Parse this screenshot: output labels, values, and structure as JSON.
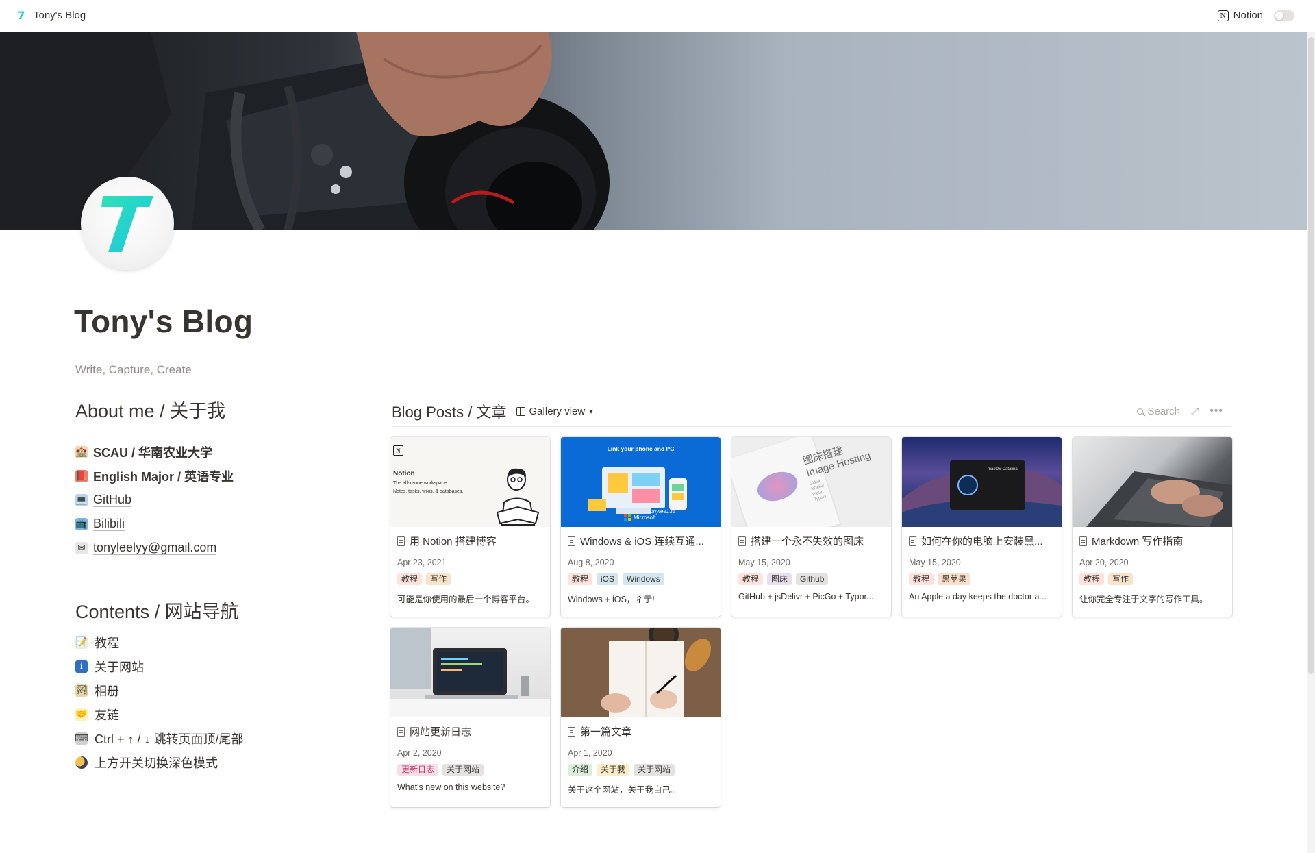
{
  "topbar": {
    "site_name": "Tony's Blog",
    "notion_label": "Notion",
    "dark_mode_enabled": false
  },
  "page": {
    "title": "Tony's Blog",
    "subtitle": "Write, Capture, Create"
  },
  "about": {
    "heading": "About me / 关于我",
    "items": [
      {
        "icon": "school-icon",
        "text": "SCAU / 华南农业大学",
        "style": "bold"
      },
      {
        "icon": "book-icon",
        "text": "English Major / 英语专业",
        "style": "bold"
      },
      {
        "icon": "computer-icon",
        "text": "GitHub",
        "style": "link"
      },
      {
        "icon": "tv-icon",
        "text": "Bilibili",
        "style": "link"
      },
      {
        "icon": "envelope-icon",
        "text": "tonyleelyy@gmail.com",
        "style": "link"
      }
    ]
  },
  "contents": {
    "heading": "Contents / 网站导航",
    "items": [
      {
        "icon": "memo-icon",
        "text": "教程"
      },
      {
        "icon": "info-icon",
        "text": "关于网站"
      },
      {
        "icon": "picture-icon",
        "text": "相册"
      },
      {
        "icon": "handshake-icon",
        "text": "友链"
      },
      {
        "icon": "keyboard-icon",
        "text": "Ctrl + ↑ / ↓ 跳转页面顶/尾部"
      },
      {
        "icon": "moon-icon",
        "text": "上方开关切换深色模式"
      }
    ]
  },
  "gallery": {
    "title": "Blog Posts / 文章",
    "view_label": "Gallery view",
    "search_label": "Search",
    "posts": [
      {
        "title": "用 Notion 搭建博客",
        "date": "Apr 23, 2021",
        "tags": [
          "教程",
          "写作"
        ],
        "desc": "可能是你使用的最后一个博客平台。",
        "cover": "notion",
        "cover_text": {
          "brand": "Notion",
          "line1": "The all-in-one workspace.",
          "line2": "Notes, tasks, wikis, & databases."
        }
      },
      {
        "title": "Windows & iOS 连续互通...",
        "date": "Aug 8, 2020",
        "tags": [
          "教程",
          "iOS",
          "Windows"
        ],
        "desc": "Windows + iOS，彳亍!",
        "cover": "windows",
        "cover_text": {
          "line1": "Link your phone and PC",
          "signature": "tonylee133",
          "brand": "Microsoft"
        }
      },
      {
        "title": "搭建一个永不失效的图床",
        "date": "May 15, 2020",
        "tags": [
          "教程",
          "图床",
          "Github"
        ],
        "desc": "GitHub + jsDelivr + PicGo + Typor...",
        "cover": "hosting",
        "cover_text": {
          "line1": "图床搭建",
          "line2": "Image Hosting",
          "items": [
            "Github",
            "jsDelivr",
            "PicGo",
            "Typora"
          ]
        }
      },
      {
        "title": "如何在你的电脑上安装黑...",
        "date": "May 15, 2020",
        "tags": [
          "教程",
          "黑苹果"
        ],
        "desc": "An Apple a day keeps the doctor a...",
        "cover": "catalina",
        "cover_text": {
          "line1": "macOS Catalina"
        }
      },
      {
        "title": "Markdown 写作指南",
        "date": "Apr 20, 2020",
        "tags": [
          "教程",
          "写作"
        ],
        "desc": "让你完全专注于文字的写作工具。",
        "cover": "keyboard"
      },
      {
        "title": "网站更新日志",
        "date": "Apr 2, 2020",
        "tags": [
          "更新日志",
          "关于网站"
        ],
        "desc": "What's new on this website?",
        "cover": "laptop"
      },
      {
        "title": "第一篇文章",
        "date": "Apr 1, 2020",
        "tags": [
          "介绍",
          "关于我",
          "关于网站"
        ],
        "desc": "关于这个网站，关于我自己。",
        "cover": "notebook"
      }
    ],
    "tag_colors": {
      "教程": "#ffe2dd",
      "写作": "#f8e4cb",
      "iOS": "#d3e5ef",
      "Windows": "#d3e5ef",
      "图床": "#e8deee",
      "Github": "#e3e2e0",
      "黑苹果": "#fadec9",
      "更新日志": "#f5e0e9",
      "关于网站": "#e3e2e0",
      "介绍": "#dbeddb",
      "关于我": "#fdecc8"
    }
  }
}
